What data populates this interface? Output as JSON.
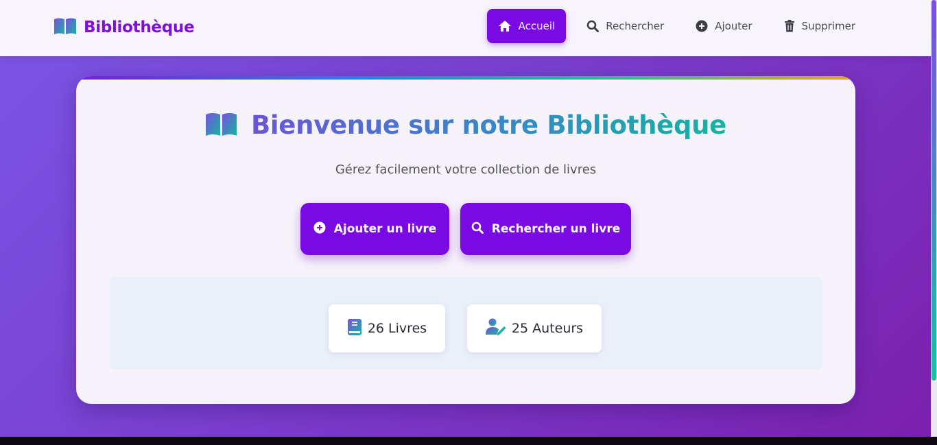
{
  "brand": {
    "name": "Bibliothèque"
  },
  "nav": {
    "items": [
      {
        "label": "Accueil",
        "icon": "home-icon",
        "active": true
      },
      {
        "label": "Rechercher",
        "icon": "search-icon",
        "active": false
      },
      {
        "label": "Ajouter",
        "icon": "plus-circle-icon",
        "active": false
      },
      {
        "label": "Supprimer",
        "icon": "trash-icon",
        "active": false
      }
    ]
  },
  "hero": {
    "title": "Bienvenue sur notre Bibliothèque",
    "subtitle": "Gérez facilement votre collection de livres"
  },
  "actions": {
    "add_label": "Ajouter un livre",
    "search_label": "Rechercher un livre"
  },
  "stats": {
    "books": {
      "count": "26",
      "label": "Livres",
      "text": "26 Livres"
    },
    "authors": {
      "count": "25",
      "label": "Auteurs",
      "text": "25 Auteurs"
    }
  },
  "colors": {
    "primary": "#7a0ae4",
    "brand_text": "#7e0fd8",
    "background_start": "#7b55e6",
    "background_end": "#7b1fae",
    "teal": "#12b5a0"
  }
}
